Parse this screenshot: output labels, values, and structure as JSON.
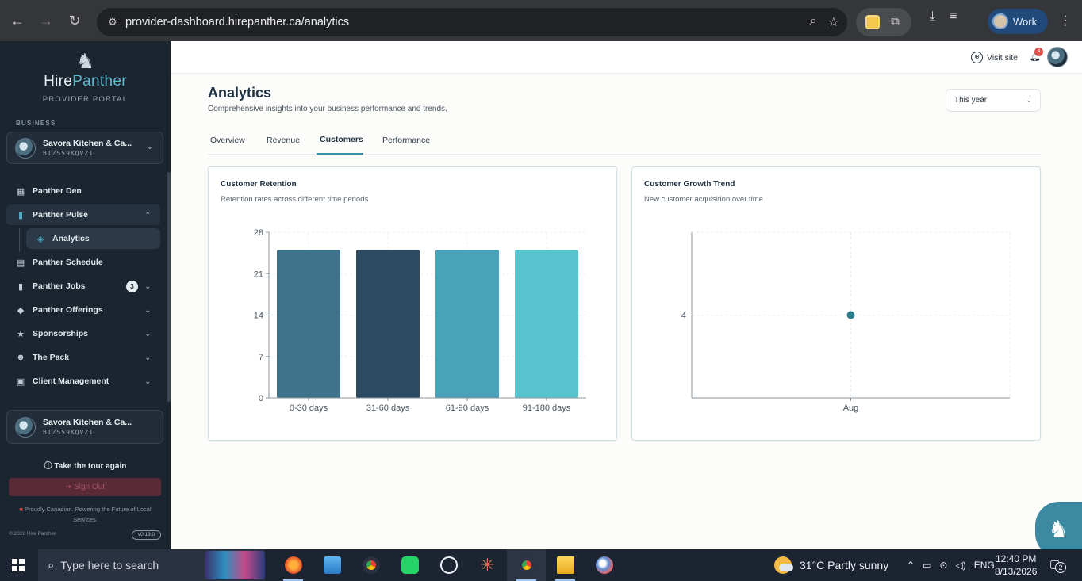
{
  "browser": {
    "url_host": "provider-dashboard.hirepanther.ca",
    "url_path": "/analytics",
    "profile_label": "Work"
  },
  "sidebar": {
    "brand_hire": "Hire",
    "brand_panther": "Panther",
    "portal_label": "PROVIDER PORTAL",
    "section_label": "BUSINESS",
    "business_name": "Savora Kitchen & Ca...",
    "business_id": "BIZS59KQVZ1",
    "items": [
      {
        "label": "Panther Den",
        "icon": "grid-icon"
      },
      {
        "label": "Panther Pulse",
        "icon": "bar-chart-icon"
      },
      {
        "label": "Analytics",
        "icon": "layers-icon"
      },
      {
        "label": "Panther Schedule",
        "icon": "calendar-icon"
      },
      {
        "label": "Panther Jobs",
        "icon": "bookmark-icon",
        "badge": "3"
      },
      {
        "label": "Panther Offerings",
        "icon": "tag-icon"
      },
      {
        "label": "Sponsorships",
        "icon": "star-icon"
      },
      {
        "label": "The Pack",
        "icon": "users-icon"
      },
      {
        "label": "Client Management",
        "icon": "contact-icon"
      }
    ],
    "bottom_business_name": "Savora Kitchen & Ca...",
    "bottom_business_id": "BIZS59KQVZ1",
    "tour_label": "Take the tour again",
    "signout_label": "Sign Out",
    "footer_note": "Proudly Canadian. Powering the Future of Local Services.",
    "copyright": "© 2026 Hire Panther",
    "version": "v0.19.0"
  },
  "topbar": {
    "visit_site": "Visit site",
    "notification_count": "4"
  },
  "page": {
    "title": "Analytics",
    "subtitle": "Comprehensive insights into your business performance and trends.",
    "period": "This year",
    "tabs": [
      "Overview",
      "Revenue",
      "Customers",
      "Performance"
    ],
    "active_tab": "Customers"
  },
  "chart_data": [
    {
      "type": "bar",
      "title": "Customer Retention",
      "subtitle": "Retention rates across different time periods",
      "categories": [
        "0-30 days",
        "31-60 days",
        "61-90 days",
        "91-180 days"
      ],
      "values": [
        25,
        25,
        25,
        25
      ],
      "ylim": [
        0,
        28
      ],
      "yticks": [
        0,
        7,
        14,
        21,
        28
      ],
      "colors": [
        "#3f738b",
        "#2c4a62",
        "#4aa1ba",
        "#57c3cf"
      ],
      "grid": true
    },
    {
      "type": "line",
      "title": "Customer Growth Trend",
      "subtitle": "New customer acquisition over time",
      "categories": [
        "Aug"
      ],
      "values": [
        4
      ],
      "yticks": [
        4
      ],
      "color": "#2e7d8c",
      "grid": true
    }
  ],
  "taskbar": {
    "search_placeholder": "Type here to search",
    "weather": "31°C  Partly sunny",
    "language": "ENG",
    "time": "12:40 PM",
    "date": "8/13/2026",
    "notifications": "2"
  }
}
